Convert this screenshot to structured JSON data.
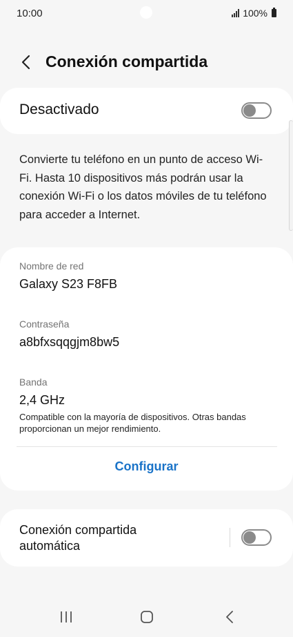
{
  "status_bar": {
    "time": "10:00",
    "battery_text": "100%",
    "icons": [
      "signal-icon",
      "battery-icon"
    ]
  },
  "header": {
    "title": "Conexión compartida",
    "back_icon": "back-arrow-icon"
  },
  "master_switch": {
    "label": "Desactivado",
    "state": "off"
  },
  "description": "Convierte tu teléfono en un punto de acceso Wi-Fi. Hasta 10 dispositivos más podrán usar la conexión Wi-Fi o los datos móviles de tu teléfono para acceder a Internet.",
  "details": {
    "network_name_label": "Nombre de red",
    "network_name_value": "Galaxy S23 F8FB",
    "password_label": "Contraseña",
    "password_value": "a8bfxsqqgjm8bw5",
    "band_label": "Banda",
    "band_value": "2,4 GHz",
    "band_note": "Compatible con la mayoría de dispositivos. Otras bandas proporcionan un mejor rendimiento.",
    "configure_label": "Configurar"
  },
  "auto_switch": {
    "label": "Conexión compartida automática",
    "state": "off"
  },
  "nav_bar": {
    "icons": [
      "recents-icon",
      "home-icon",
      "back-icon"
    ]
  },
  "colors": {
    "accent": "#1a73c8",
    "background": "#f6f6f6",
    "card": "#ffffff",
    "toggle_off": "#8a8a8a"
  }
}
